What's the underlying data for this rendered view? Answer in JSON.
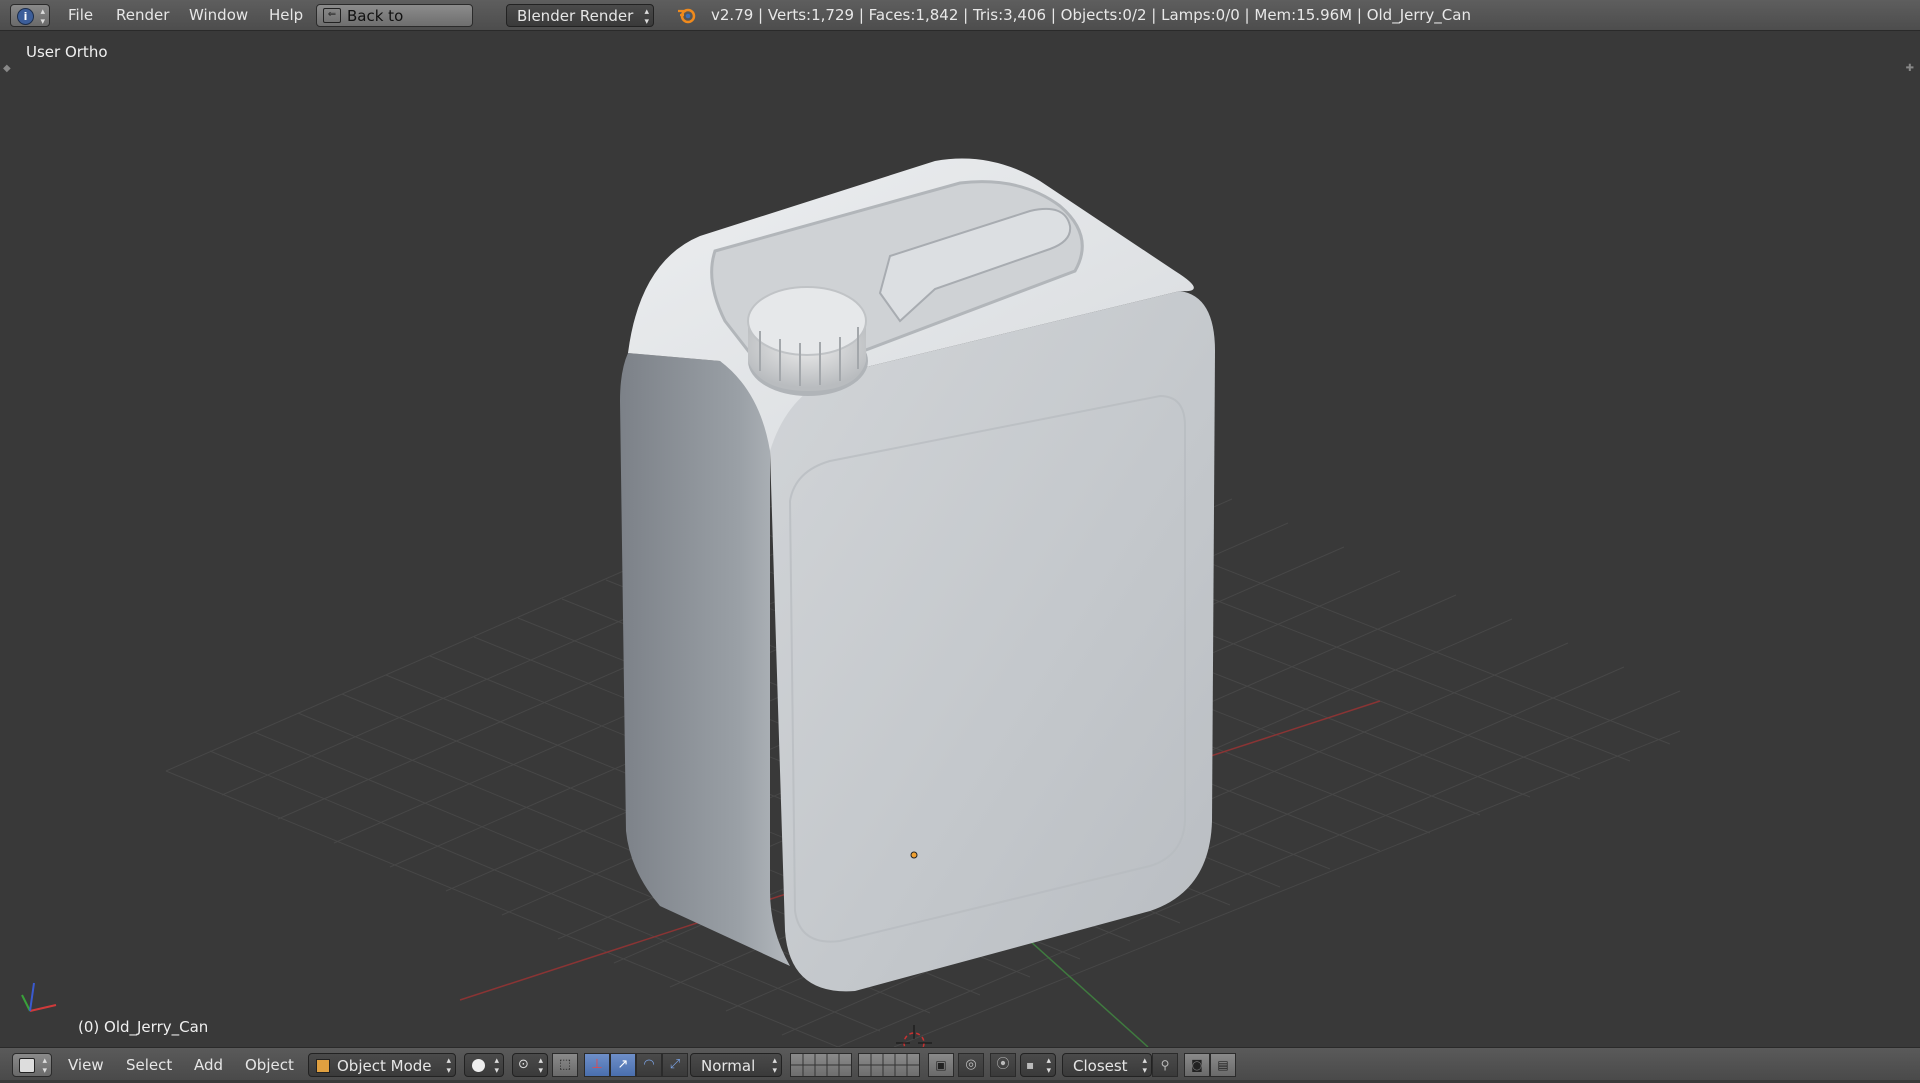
{
  "top_bar": {
    "menus": [
      "File",
      "Render",
      "Window",
      "Help"
    ],
    "back_button": "Back to Previous",
    "render_engine": "Blender Render",
    "stats": "v2.79 | Verts:1,729 | Faces:1,842 | Tris:3,406 | Objects:0/2 | Lamps:0/0 | Mem:15.96M | Old_Jerry_Can",
    "info_icon": "info-icon",
    "blender_icon": "blender-logo-icon"
  },
  "viewport": {
    "view_name": "User Ortho",
    "active_object": "(0) Old_Jerry_Can",
    "background_color": "#393939",
    "grid_color": "#4a4a4a",
    "x_axis_color": "#8a3434",
    "y_axis_color": "#3f7a3f",
    "model_color": "#c8ccd0"
  },
  "bottom_bar": {
    "menus": [
      "View",
      "Select",
      "Add",
      "Object"
    ],
    "mode": "Object Mode",
    "pivot_orientation": "Normal",
    "snap_target": "Closest",
    "icons": [
      "3d-view-editor-icon",
      "mode-cube-icon",
      "viewport-shading-icon",
      "pivot-point-icon",
      "manipulator-icon",
      "translate-icon",
      "rotate-icon",
      "scale-icon",
      "layers-icon",
      "lock-icon",
      "proportional-edit-icon",
      "snap-icon",
      "snap-element-icon",
      "render-icon",
      "render-animation-icon"
    ]
  }
}
